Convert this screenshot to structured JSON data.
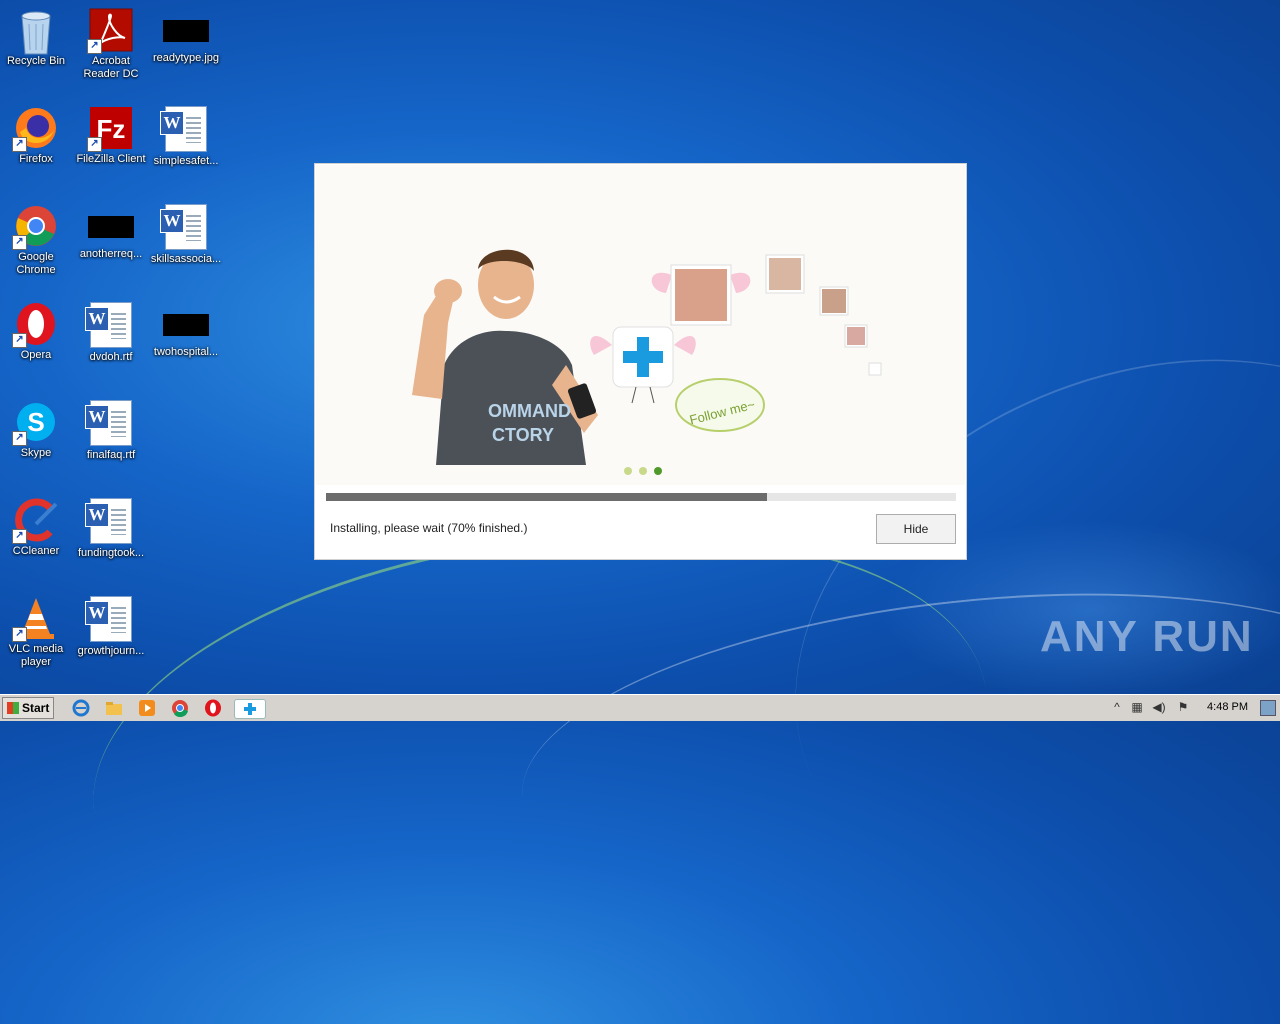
{
  "desktop": {
    "icons": [
      {
        "label": "Recycle Bin"
      },
      {
        "label": "Acrobat Reader DC"
      },
      {
        "label": "readytype.jpg"
      },
      {
        "label": "Firefox"
      },
      {
        "label": "FileZilla Client"
      },
      {
        "label": "simplesafet..."
      },
      {
        "label": "Google Chrome"
      },
      {
        "label": "anotherreq..."
      },
      {
        "label": "skillsassocia..."
      },
      {
        "label": "Opera"
      },
      {
        "label": "dvdoh.rtf"
      },
      {
        "label": "twohospital..."
      },
      {
        "label": "Skype"
      },
      {
        "label": "finalfaq.rtf"
      },
      {
        "label": "CCleaner"
      },
      {
        "label": "fundingtook..."
      },
      {
        "label": "VLC media player"
      },
      {
        "label": "growthjourn..."
      }
    ]
  },
  "installer": {
    "banner_caption": "Follow me~",
    "progress_percent": 70,
    "status_text": "Installing, please wait (70% finished.)",
    "hide_label": "Hide",
    "slide_count": 3,
    "active_slide": 3
  },
  "taskbar": {
    "start_label": "Start",
    "clock": "4:48 PM"
  },
  "watermark": "ANY RUN",
  "colors": {
    "desktop_blue": "#1565c8",
    "progress_fill": "#6c6c6c",
    "installer_accent": "#1a9be0"
  }
}
